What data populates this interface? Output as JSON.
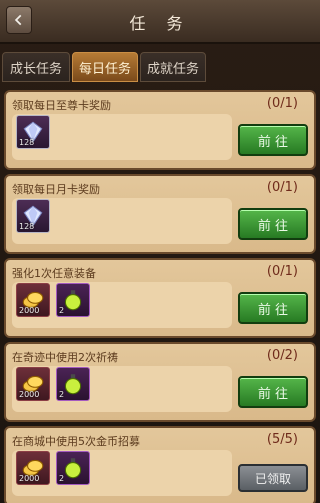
{
  "header": {
    "title": "任 务"
  },
  "tabs": [
    {
      "label": "成长任务",
      "active": false
    },
    {
      "label": "每日任务",
      "active": true
    },
    {
      "label": "成就任务",
      "active": false
    }
  ],
  "tasks": [
    {
      "title": "领取每日至尊卡奖励",
      "progress": "(0/1)",
      "rewards": [
        {
          "icon": "diamond-icon",
          "qty": "128"
        }
      ],
      "action": "前 往",
      "state": "go"
    },
    {
      "title": "领取每日月卡奖励",
      "progress": "(0/1)",
      "rewards": [
        {
          "icon": "diamond-icon",
          "qty": "128"
        }
      ],
      "action": "前 往",
      "state": "go"
    },
    {
      "title": "强化1次任意装备",
      "progress": "(0/1)",
      "rewards": [
        {
          "icon": "gold-coins-icon",
          "qty": "2000"
        },
        {
          "icon": "potion-icon",
          "qty": "2"
        }
      ],
      "action": "前 往",
      "state": "go"
    },
    {
      "title": "在奇迹中使用2次祈祷",
      "progress": "(0/2)",
      "rewards": [
        {
          "icon": "gold-coins-icon",
          "qty": "2000"
        },
        {
          "icon": "potion-icon",
          "qty": "2"
        }
      ],
      "action": "前 往",
      "state": "go"
    },
    {
      "title": "在商城中使用5次金币招募",
      "progress": "(5/5)",
      "rewards": [
        {
          "icon": "gold-coins-icon",
          "qty": "2000"
        },
        {
          "icon": "potion-icon",
          "qty": "2"
        }
      ],
      "action": "已领取",
      "state": "claimed"
    }
  ]
}
